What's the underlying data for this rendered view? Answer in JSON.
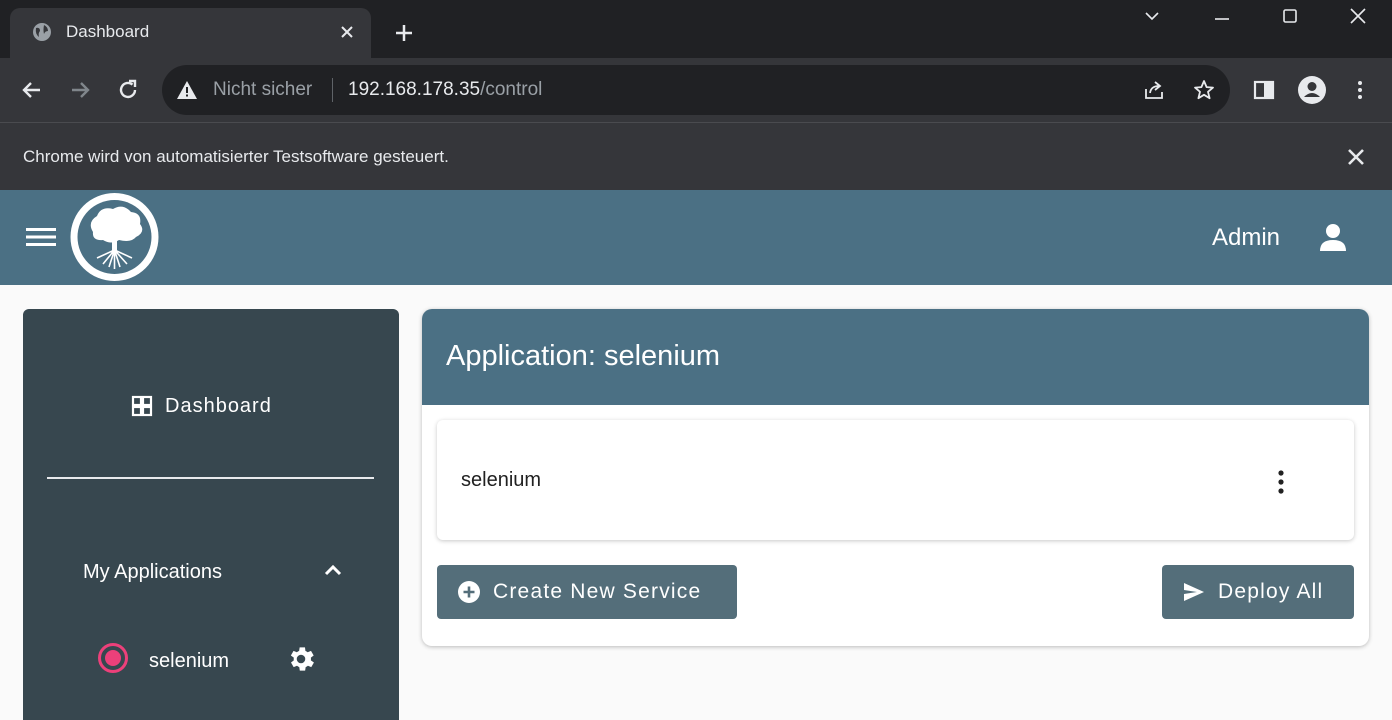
{
  "browser": {
    "tab_title": "Dashboard",
    "omnibox": {
      "security_label": "Nicht sicher",
      "url_host": "192.168.178.35",
      "url_path": "/control"
    },
    "infobar_text": "Chrome wird von automatisierter Testsoftware gesteuert."
  },
  "app": {
    "header": {
      "user_label": "Admin"
    },
    "sidebar": {
      "dashboard_label": "Dashboard",
      "section_label": "My Applications",
      "items": [
        {
          "label": "selenium",
          "icon": "radio-selected-icon",
          "color": "#ec407a"
        }
      ]
    },
    "main": {
      "title": "Application: selenium",
      "services": [
        {
          "name": "selenium"
        }
      ],
      "create_button_label": "Create New Service",
      "deploy_button_label": "Deploy All"
    }
  },
  "colors": {
    "primary": "#4b7084",
    "sidebar": "#37474f",
    "button": "#546e7a",
    "accent": "#ec407a"
  }
}
